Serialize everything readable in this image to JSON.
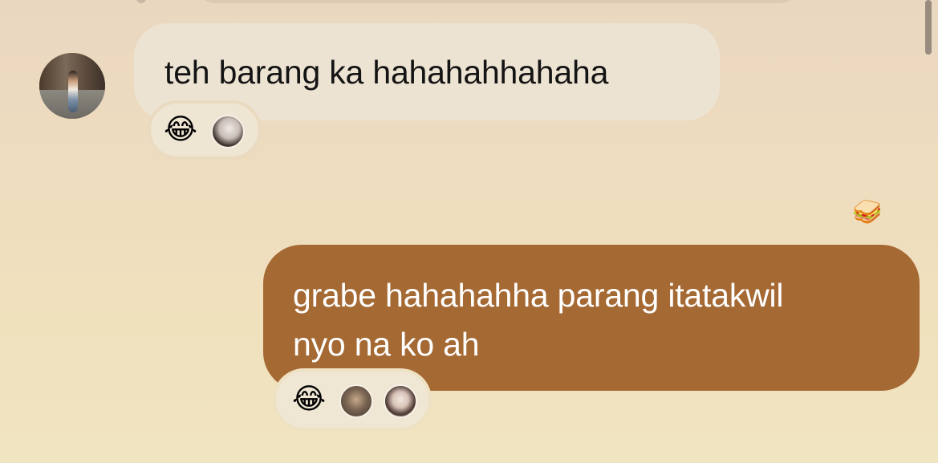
{
  "messages": [
    {
      "direction": "incoming",
      "text": "teh barang ka hahahahhahaha",
      "reactions": {
        "emoji": "😂",
        "reactors": [
          "reactor-avatar"
        ]
      }
    },
    {
      "direction": "outgoing",
      "lines": [
        "grabe hahahahha parang itatakwil",
        "nyo na ko ah"
      ],
      "side_sticker": "🥪",
      "reactions": {
        "emoji": "😂",
        "reactors": [
          "reactor-avatar",
          "reactor-avatar"
        ]
      }
    }
  ],
  "colors": {
    "incoming_bubble": "#ede3d3",
    "outgoing_bubble": "#a56933",
    "background_top": "#ead7c0",
    "background_bottom": "#f1e4c1"
  },
  "icons": [
    "laughing-emoji-icon",
    "sandwich-icon"
  ]
}
